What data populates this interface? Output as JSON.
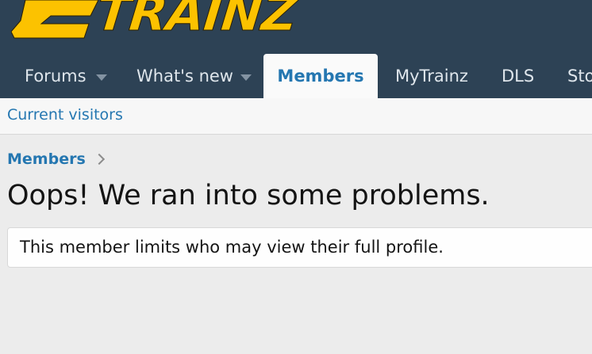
{
  "header": {
    "logo_text": "TRAINZ",
    "colors": {
      "header_bg": "#2d4255",
      "logo_yellow": "#fcc200",
      "accent_blue": "#2577b1"
    }
  },
  "nav": {
    "tabs": [
      {
        "label": "Forums",
        "has_dropdown": true,
        "active": false
      },
      {
        "label": "What's new",
        "has_dropdown": true,
        "active": false
      },
      {
        "label": "Members",
        "has_dropdown": false,
        "active": true
      },
      {
        "label": "MyTrainz",
        "has_dropdown": false,
        "active": false
      },
      {
        "label": "DLS",
        "has_dropdown": false,
        "active": false
      },
      {
        "label": "Sto",
        "has_dropdown": false,
        "active": false
      }
    ]
  },
  "subnav": {
    "link_label": "Current visitors"
  },
  "breadcrumb": {
    "label": "Members"
  },
  "main": {
    "title": "Oops! We ran into some problems.",
    "message": "This member limits who may view their full profile."
  }
}
